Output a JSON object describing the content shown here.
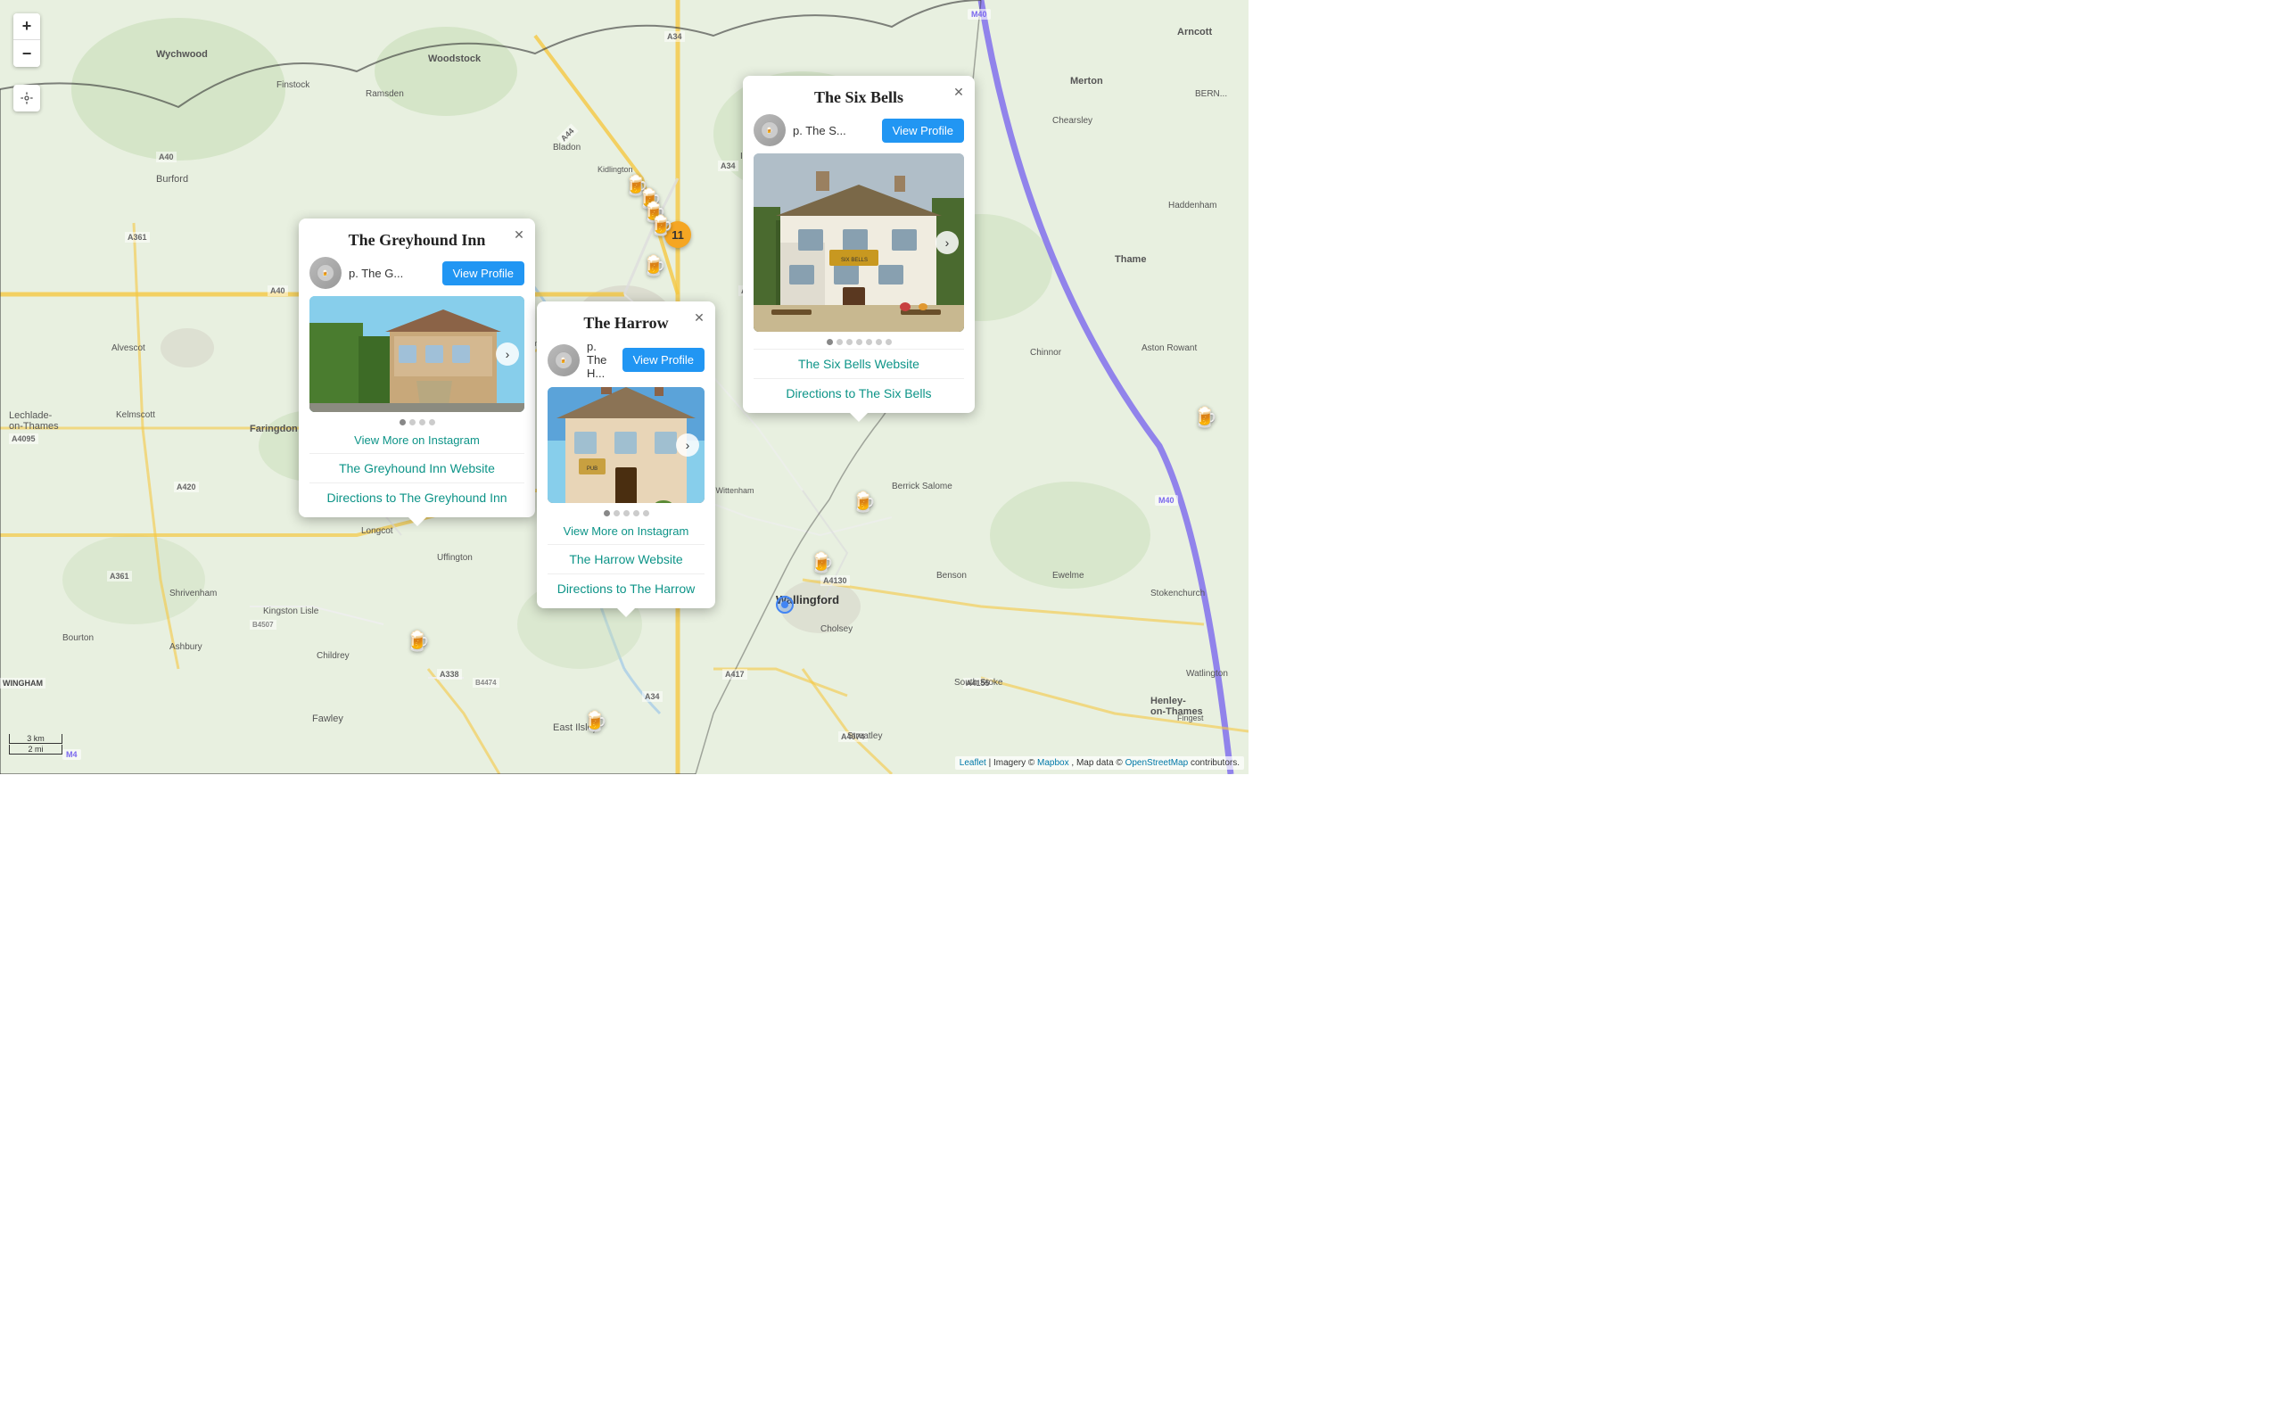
{
  "map": {
    "zoom_in": "+",
    "zoom_out": "−",
    "attribution_text": "Leaflet | Imagery © Mapbox, Map data © OpenStreetMap contributors.",
    "attribution_leaflet": "Leaflet",
    "attribution_mapbox": "Mapbox",
    "attribution_osm": "OpenStreetMap",
    "scale_km": "3 km",
    "scale_mi": "2 mi"
  },
  "popups": {
    "greyhound": {
      "title": "The Greyhound Inn",
      "pub_initial": "p.",
      "pub_name_short": "The G...",
      "view_profile_label": "View Profile",
      "instagram_label": "View More on Instagram",
      "website_label": "The Greyhound Inn Website",
      "directions_label": "Directions to The Greyhound Inn",
      "carousel_dots": [
        true,
        false,
        false,
        false
      ],
      "image_alt": "The Greyhound Inn exterior"
    },
    "harrow": {
      "title": "The Harrow",
      "pub_initial": "p.",
      "pub_name_short": "The H...",
      "view_profile_label": "View Profile",
      "instagram_label": "View More on Instagram",
      "website_label": "The Harrow Website",
      "directions_label": "Directions to The Harrow",
      "carousel_dots": [
        true,
        false,
        false,
        false,
        false
      ],
      "image_alt": "The Harrow exterior"
    },
    "sixbells": {
      "title": "The Six Bells",
      "pub_initial": "p.",
      "pub_name_short": "The S...",
      "view_profile_label": "View Profile",
      "website_label": "The Six Bells Website",
      "directions_label": "Directions to The Six Bells",
      "carousel_dots": [
        true,
        false,
        false,
        false,
        false,
        false,
        false
      ],
      "image_alt": "The Six Bells exterior"
    }
  },
  "markers": {
    "cluster_label": "11"
  }
}
